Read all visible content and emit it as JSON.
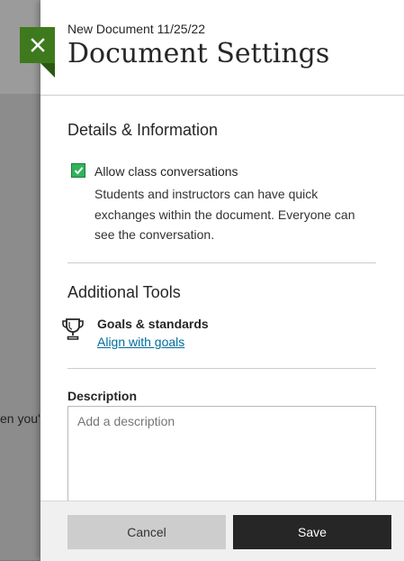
{
  "background": {
    "partial_text": "en you'"
  },
  "close_button": {
    "icon": "close-icon",
    "color": "#3e7a1d"
  },
  "header": {
    "document_name": "New Document 11/25/22",
    "title": "Document Settings"
  },
  "details_section": {
    "title": "Details & Information",
    "allow_conversations": {
      "checked": true,
      "label": "Allow class conversations",
      "description": "Students and instructors can have quick exchanges within the document. Everyone can see the conversation."
    }
  },
  "tools_section": {
    "title": "Additional Tools",
    "goals": {
      "icon": "trophy-icon",
      "title": "Goals & standards",
      "link": "Align with goals"
    }
  },
  "description": {
    "label": "Description",
    "placeholder": "Add a description",
    "value": ""
  },
  "footer": {
    "cancel_label": "Cancel",
    "save_label": "Save"
  }
}
